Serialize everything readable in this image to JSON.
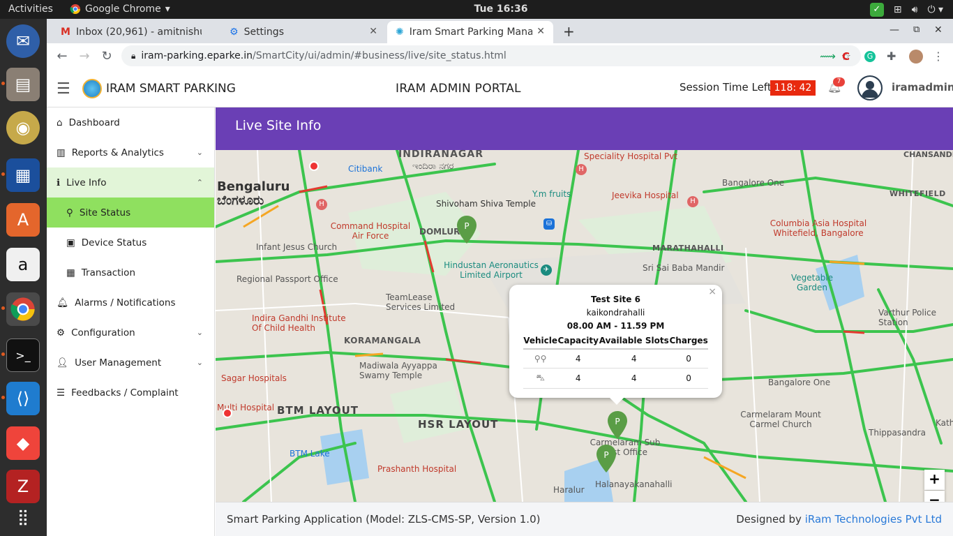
{
  "system": {
    "activities": "Activities",
    "app_menu": "Google Chrome",
    "clock": "Tue 16:36"
  },
  "dock": {
    "items": [
      "thunderbird-icon",
      "files-icon",
      "rhythmbox-icon",
      "writer-icon",
      "software-icon",
      "amazon-icon",
      "chrome-icon",
      "terminal-icon",
      "vscode-icon",
      "anydesk-icon",
      "filezilla-icon",
      "apps-grid-icon"
    ]
  },
  "browser": {
    "tabs": [
      {
        "label": "Inbox (20,961) - amitnishu",
        "icon": "gmail-icon"
      },
      {
        "label": "Settings",
        "icon": "gear-icon"
      },
      {
        "label": "Iram Smart Parking Mana",
        "icon": "iram-icon"
      }
    ],
    "url_host": "iram-parking.eparke.in",
    "url_path": "/SmartCity/ui/admin/#business/live/site_status.html"
  },
  "header": {
    "brand": "IRAM SMART PARKING",
    "portal_title": "IRAM ADMIN PORTAL",
    "session_label": "Session Time Left:",
    "session_time": "118: 42",
    "notif_count": "7",
    "username": "iramadmin"
  },
  "sidebar": {
    "items": [
      {
        "label": "Dashboard",
        "icon": "home-icon"
      },
      {
        "label": "Reports & Analytics",
        "icon": "chart-icon"
      },
      {
        "label": "Live Info",
        "icon": "info-icon"
      },
      {
        "label": "Site Status",
        "icon": "map-pin-icon"
      },
      {
        "label": "Device Status",
        "icon": "chip-icon"
      },
      {
        "label": "Transaction",
        "icon": "table-icon"
      },
      {
        "label": "Alarms / Notifications",
        "icon": "bell-icon"
      },
      {
        "label": "Configuration",
        "icon": "cogs-icon"
      },
      {
        "label": "User Management",
        "icon": "user-icon"
      },
      {
        "label": "Feedbacks / Complaint",
        "icon": "list-icon"
      }
    ]
  },
  "page": {
    "title": "Live Site Info"
  },
  "map": {
    "labels": [
      "INDIRANAGAR",
      "ಇಂದಿರಾ ನಗರ",
      "Bengaluru",
      "ಬೆಂಗಳೂರು",
      "Citibank",
      "Shivoham Shiva Temple",
      "DOMLUR",
      "Command Hospital Air Force",
      "Infant Jesus Church",
      "Hindustan Aeronautics Limited Airport",
      "Regional Passport Office",
      "TeamLease Services Limited",
      "Indira Gandhi Institute Of Child Health",
      "KORAMANGALA",
      "Madiwala Ayyappa Swamy Temple",
      "Sagar Hospitals",
      "BTM LAYOUT",
      "HSR LAYOUT",
      "BTM Lake",
      "Prashanth Hospital",
      "Jeevika Hospital",
      "Bangalore One",
      "WHITEFIELD",
      "Columbia Asia Hospital Whitefield, Bangalore",
      "MARATHAHALLI",
      "Sri Sai Baba Mandir",
      "Vegetable Garden",
      "Varthur Police Station",
      "Carmelaram Mount Carmel Church",
      "Thippasandra",
      "Carmelaram Sub Post Office",
      "Halanayakanahalli",
      "Haralur",
      "Y.m fruits",
      "Speciality Hospital Pvt",
      "CHANSANDRA",
      "Multi Hospital",
      "Bangalore One",
      "Kathir"
    ],
    "popup": {
      "site": "Test Site 6",
      "area": "kaikondrahalli",
      "hours": "08.00 AM - 11.59 PM",
      "headers": [
        "Vehicle",
        "Capacity",
        "Available Slots",
        "Charges"
      ],
      "rows": [
        {
          "icon": "bike-icon",
          "capacity": "4",
          "available": "4",
          "charges": "0"
        },
        {
          "icon": "car-icon",
          "capacity": "4",
          "available": "4",
          "charges": "0"
        }
      ]
    },
    "markers": [
      "P",
      "P",
      "P"
    ]
  },
  "footer": {
    "app_info": "Smart Parking Application (Model: ZLS-CMS-SP, Version 1.0)",
    "designed_by": "Designed by",
    "company": "iRam Technologies Pvt Ltd"
  },
  "colors": {
    "banner": "#6a3fb5",
    "active_item": "#8fe05f",
    "expanded_bg": "#e2f5d8",
    "session_badge": "#e8290e",
    "marker": "#5a9d46"
  }
}
